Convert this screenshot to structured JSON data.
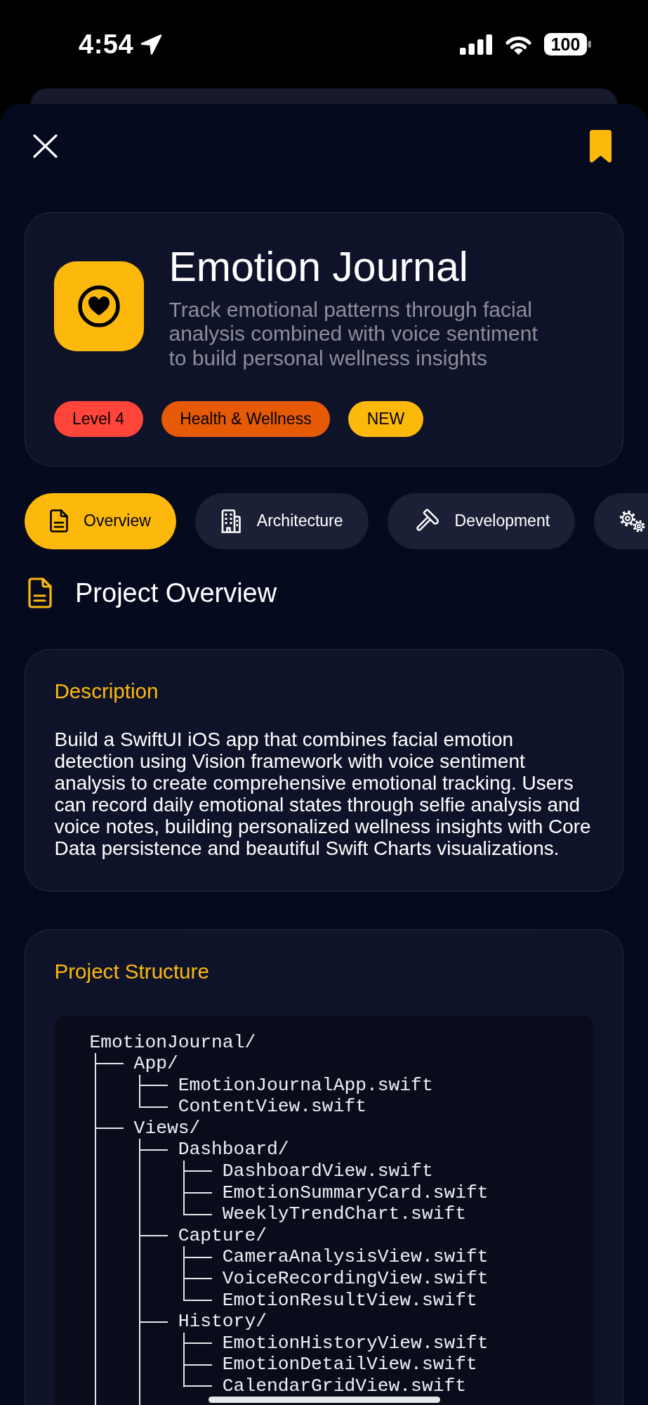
{
  "status_bar": {
    "time": "4:54",
    "battery": "100"
  },
  "toolbar": {
    "bookmarked": true
  },
  "app": {
    "title": "Emotion Journal",
    "subtitle": "Track emotional patterns through facial analysis combined with voice sentiment to build personal wellness insights",
    "tags": [
      {
        "label": "Level 4",
        "color": "#ff453a"
      },
      {
        "label": "Health & Wellness",
        "color": "#e65a06"
      },
      {
        "label": "NEW",
        "color": "#fdb90b"
      }
    ]
  },
  "tabs": [
    {
      "label": "Overview",
      "selected": true
    },
    {
      "label": "Architecture",
      "selected": false
    },
    {
      "label": "Development",
      "selected": false
    },
    {
      "selected": false
    }
  ],
  "section": {
    "title": "Project Overview"
  },
  "cards": [
    {
      "kind": "text",
      "title": "Description",
      "body": "Build a SwiftUI iOS app that combines facial emotion detection using Vision framework with voice sentiment analysis to create comprehensive emotional tracking. Users can record daily emotional states through selfie analysis and voice notes, building personalized wellness insights with Core Data persistence and beautiful Swift Charts visualizations."
    },
    {
      "kind": "tree",
      "title": "Project Structure",
      "tree": {
        "name": "EmotionJournal/",
        "cut_off": true,
        "children": [
          {
            "name": "App/",
            "cut_off": false,
            "children": [
              {
                "name": "EmotionJournalApp.swift"
              },
              {
                "name": "ContentView.swift"
              }
            ]
          },
          {
            "name": "Views/",
            "cut_off": true,
            "children": [
              {
                "name": "Dashboard/",
                "cut_off": false,
                "children": [
                  {
                    "name": "DashboardView.swift"
                  },
                  {
                    "name": "EmotionSummaryCard.swift"
                  },
                  {
                    "name": "WeeklyTrendChart.swift"
                  }
                ]
              },
              {
                "name": "Capture/",
                "cut_off": false,
                "children": [
                  {
                    "name": "CameraAnalysisView.swift"
                  },
                  {
                    "name": "VoiceRecordingView.swift"
                  },
                  {
                    "name": "EmotionResultView.swift"
                  }
                ]
              },
              {
                "name": "History/",
                "cut_off": false,
                "children": [
                  {
                    "name": "EmotionHistoryView.swift"
                  },
                  {
                    "name": "EmotionDetailView.swift"
                  },
                  {
                    "name": "CalendarGridView.swift"
                  }
                ]
              }
            ]
          }
        ]
      }
    }
  ]
}
